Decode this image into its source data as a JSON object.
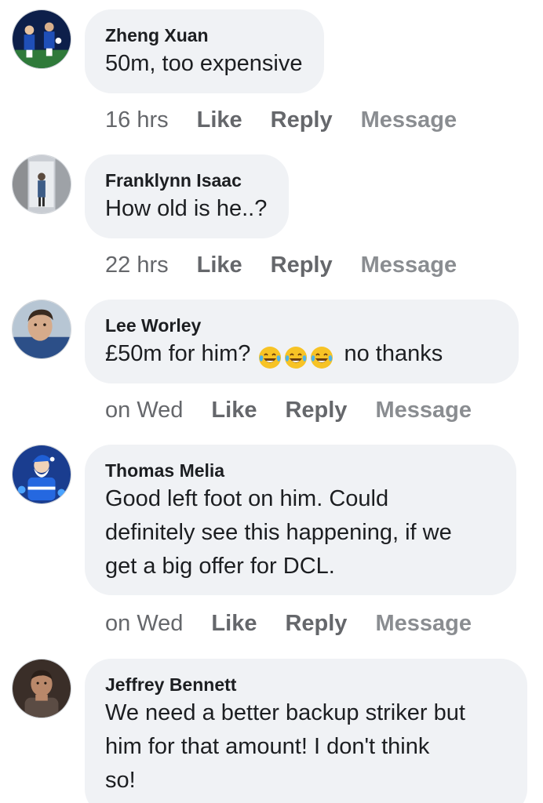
{
  "comments": [
    {
      "author": "Zheng Xuan",
      "text": "50m, too expensive",
      "time": "16 hrs",
      "avatar_icon": "football-team-avatar-icon"
    },
    {
      "author": "Franklynn Isaac",
      "text": "How old is he..?",
      "time": "22 hrs",
      "avatar_icon": "person-doorway-avatar-icon"
    },
    {
      "author": "Lee Worley",
      "text_before": "£50m for him?",
      "emoji": [
        "😂",
        "😂",
        "😂"
      ],
      "emoji_icon": "face-with-tears-of-joy-icon",
      "text_after": "no thanks",
      "time": "on Wed",
      "avatar_icon": "man-portrait-avatar-icon"
    },
    {
      "author": "Thomas Melia",
      "text_lines": [
        "Good left foot on him. Could",
        "definitely see this happening, if we",
        "get a big offer for DCL."
      ],
      "time": "on Wed",
      "avatar_icon": "blue-santa-avatar-icon"
    },
    {
      "author": "Jeffrey Bennett",
      "text_lines": [
        "We need a better backup striker but",
        "him for that amount! I don't think",
        "so!"
      ],
      "avatar_icon": "man-dark-avatar-icon"
    }
  ],
  "actions": {
    "like": "Like",
    "reply": "Reply",
    "message": "Message"
  },
  "colors": {
    "bubble": "#f0f2f5",
    "secondary_text": "#65676b",
    "everton_blue": "#1b3f91"
  }
}
